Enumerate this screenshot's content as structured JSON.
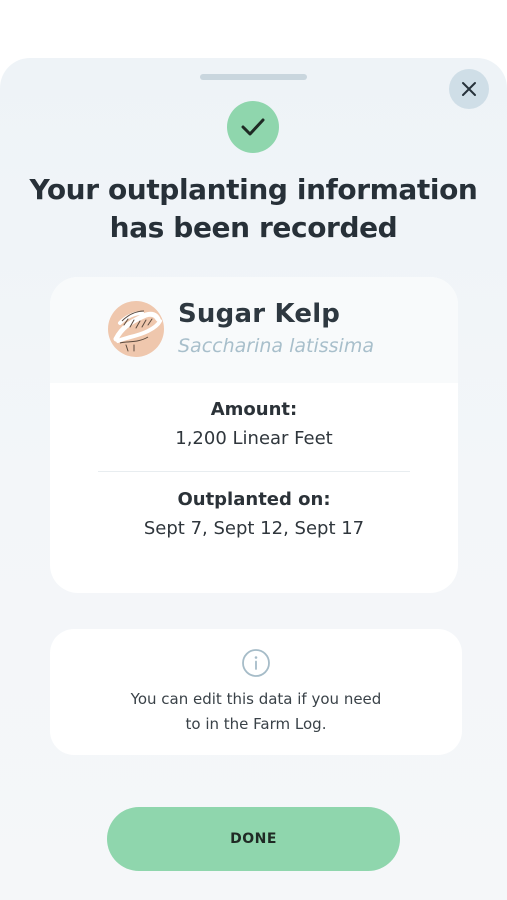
{
  "title": {
    "line1": "Your outplanting information",
    "line2": "has been recorded"
  },
  "species": {
    "common_name": "Sugar Kelp",
    "latin_name": "Saccharina latissima",
    "avatar_icon": "kelp-illustration-icon"
  },
  "amount": {
    "label": "Amount:",
    "value": "1,200 Linear Feet"
  },
  "outplanted": {
    "label": "Outplanted on:",
    "value": "Sept 7, Sept 12, Sept 17"
  },
  "info": {
    "icon": "info-icon",
    "line1": "You can edit this data if you need",
    "line2": "to in the Farm Log."
  },
  "done_button": {
    "label": "DONE"
  },
  "icons": {
    "close": "close-icon",
    "success": "checkmark-icon"
  },
  "colors": {
    "accent_green": "#8fd6ad",
    "close_bg": "#cfdee7",
    "avatar_bg": "#efc7ad",
    "latin_text": "#a8bfcb"
  }
}
